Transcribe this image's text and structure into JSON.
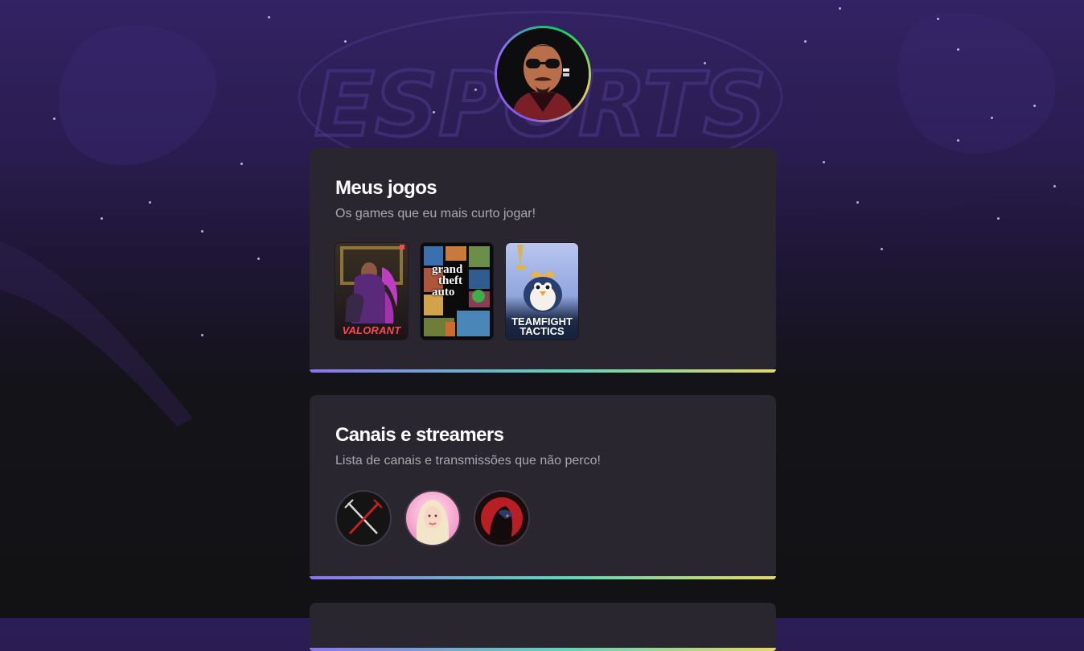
{
  "profile": {
    "avatar_icon": "profile-avatar-illustration"
  },
  "background": {
    "logo_text": "ESPORTS"
  },
  "games_card": {
    "title": "Meus jogos",
    "subtitle": "Os games que eu mais curto jogar!",
    "games": [
      {
        "name": "Valorant",
        "cover_text": "VALORANT",
        "accent": "#ff4655"
      },
      {
        "name": "Grand Theft Auto V",
        "cover_lines": [
          "grand",
          "theft",
          "auto"
        ],
        "accent": "#f2b33d"
      },
      {
        "name": "Teamfight Tactics",
        "cover_lines": [
          "TEAMFIGHT",
          "TACTICS"
        ],
        "accent": "#7fa8e6"
      }
    ]
  },
  "channels_card": {
    "title": "Canais e streamers",
    "subtitle": "Lista de canais e transmissões que não perco!",
    "channels": [
      {
        "icon": "crossed-swords-icon"
      },
      {
        "icon": "streamer-portrait-blonde"
      },
      {
        "icon": "red-warrior-icon"
      }
    ]
  },
  "colors": {
    "accent_start": "#8b74f0",
    "accent_mid": "#5fd6b9",
    "accent_end": "#e6d865",
    "card_bg": "#29262f"
  }
}
